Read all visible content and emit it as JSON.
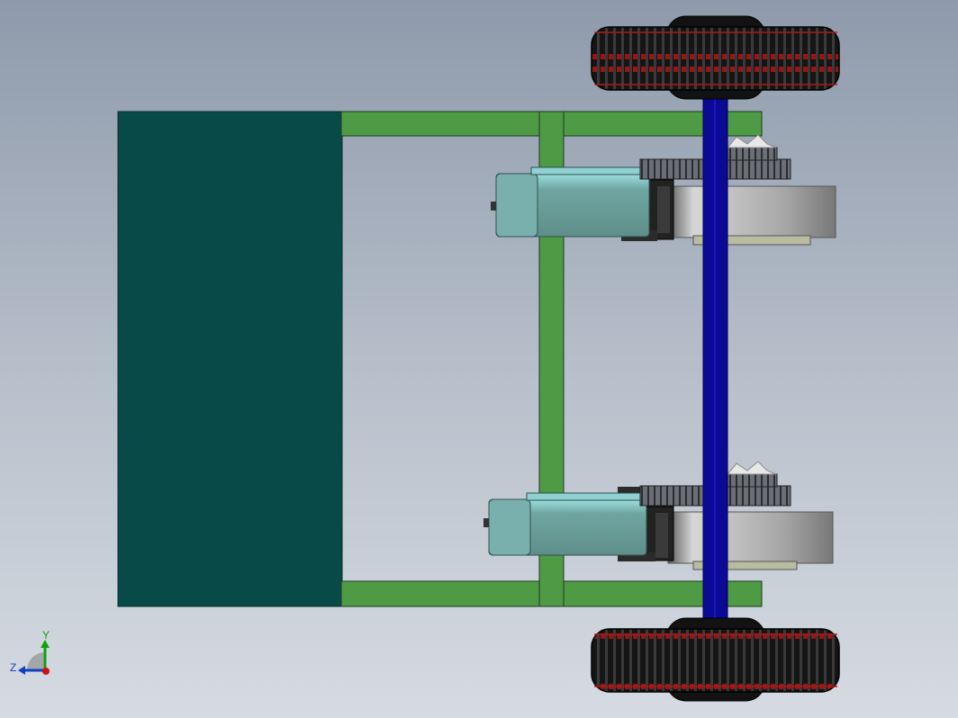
{
  "view": {
    "background_top": "#8e9aab",
    "background_bottom": "#d6dbe2"
  },
  "colors": {
    "panel": "#074a48",
    "frame": "#4e9a45",
    "axle": "#0a0a96",
    "motor": "#6f9c98",
    "motor_light": "#8fd0d0",
    "gear": "#6a6e74",
    "tire": "#111111",
    "rim_red": "#b01818",
    "drum": "#a0a0a0"
  },
  "triad": {
    "y_label": "Y",
    "z_label": "Z",
    "x_color": "#d01010",
    "y_color": "#10a010",
    "z_color": "#1040c0"
  }
}
